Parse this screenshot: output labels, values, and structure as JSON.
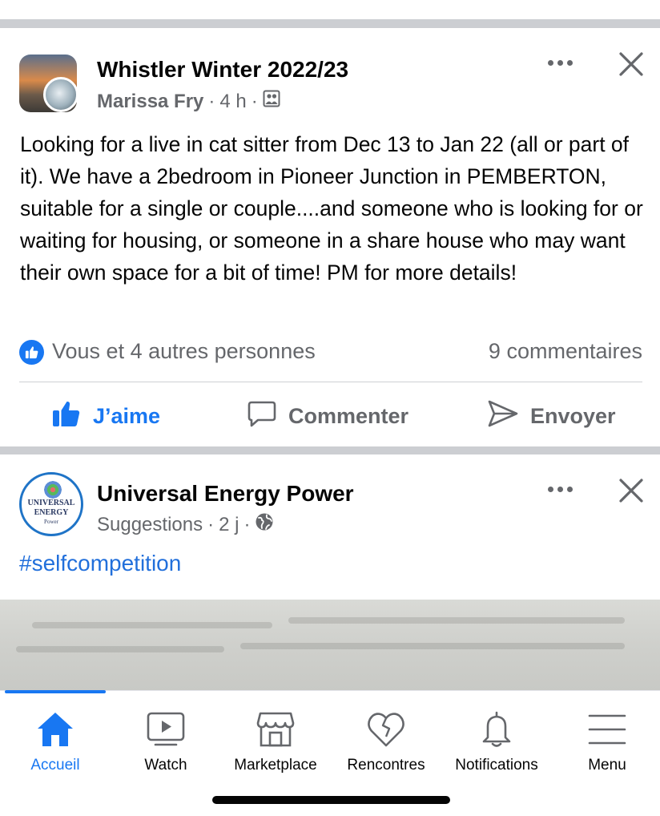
{
  "posts": [
    {
      "group_name": "Whistler Winter 2022/23",
      "author": "Marissa Fry",
      "time": "4 h",
      "separator": "·",
      "privacy_icon": "group-members-icon",
      "text": "Looking for a live in cat sitter from Dec 13 to Jan 22 (all or part of it).  We have a 2bedroom in Pioneer Junction in PEMBERTON, suitable for a single or couple....and someone who is looking for or waiting for housing, or someone in a share house who may want their own space for a bit of time!  PM for more details!",
      "reactions_text": "Vous et 4 autres personnes",
      "comments_count": "9 commentaires",
      "actions": {
        "like": "J’aime",
        "comment": "Commenter",
        "send": "Envoyer"
      }
    },
    {
      "page_name": "Universal Energy Power",
      "source": "Suggestions",
      "time": "2 j",
      "separator": "·",
      "privacy_icon": "globe-icon",
      "avatar_line1": "UNIVERSAL",
      "avatar_line2": "ENERGY",
      "avatar_line3": "Power",
      "text": "#selfcompetition"
    }
  ],
  "tabbar": {
    "tabs": [
      {
        "label": "Accueil",
        "icon": "home-icon",
        "active": true
      },
      {
        "label": "Watch",
        "icon": "watch-icon",
        "active": false
      },
      {
        "label": "Marketplace",
        "icon": "marketplace-icon",
        "active": false
      },
      {
        "label": "Rencontres",
        "icon": "dating-heart-icon",
        "active": false
      },
      {
        "label": "Notifications",
        "icon": "bell-icon",
        "active": false
      },
      {
        "label": "Menu",
        "icon": "hamburger-menu-icon",
        "active": false
      }
    ]
  },
  "colors": {
    "accent": "#1877f2",
    "secondary_text": "#65676b",
    "hashtag": "#216fdb",
    "divider": "#ccced2"
  }
}
